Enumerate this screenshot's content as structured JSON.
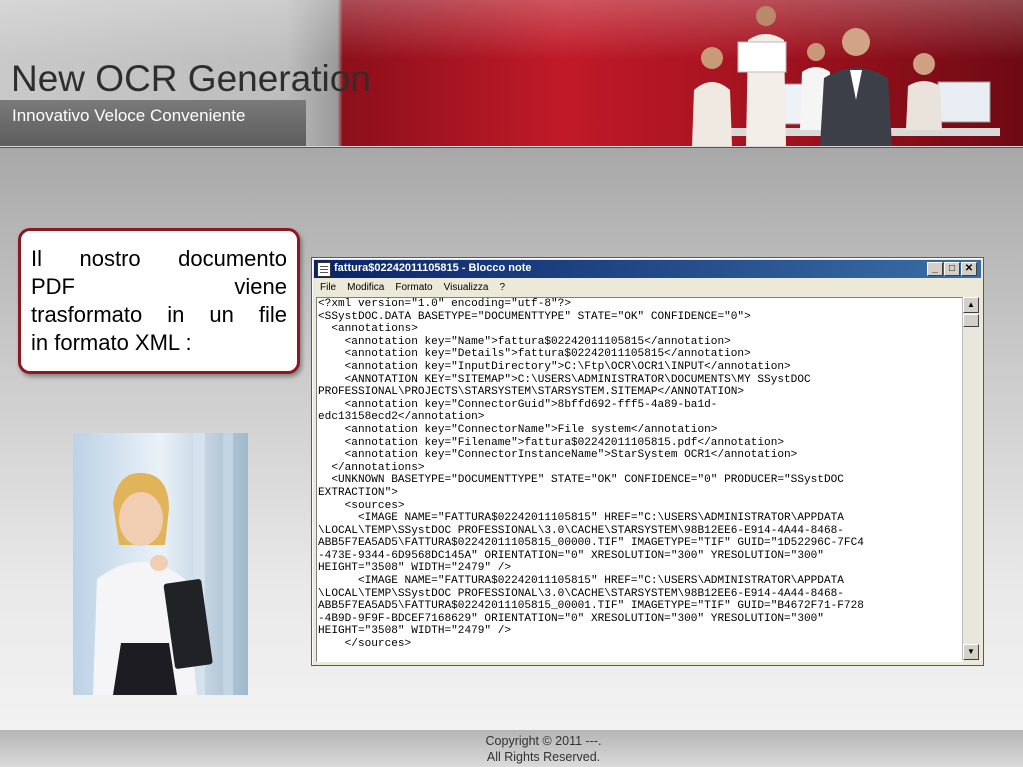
{
  "header": {
    "title": "New OCR Generation",
    "subtitle": "Innovativo Veloce Conveniente"
  },
  "callout": {
    "line1": "Il nostro documento",
    "line2": "PDF viene",
    "line3": "trasformato in un file",
    "line4": "in formato XML :"
  },
  "notepad": {
    "title": "fattura$02242011105815 - Blocco note",
    "menu": [
      "File",
      "Modifica",
      "Formato",
      "Visualizza",
      "?"
    ],
    "lines": [
      "<?xml version=\"1.0\" encoding=\"utf-8\"?>",
      "<SSystDOC.DATA BASETYPE=\"DOCUMENTTYPE\" STATE=\"OK\" CONFIDENCE=\"0\">",
      "  <annotations>",
      "    <annotation key=\"Name\">fattura$02242011105815</annotation>",
      "    <annotation key=\"Details\">fattura$02242011105815</annotation>",
      "    <annotation key=\"InputDirectory\">C:\\Ftp\\OCR\\OCR1\\INPUT</annotation>",
      "    <ANNOTATION KEY=\"SITEMAP\">C:\\USERS\\ADMINISTRATOR\\DOCUMENTS\\MY SSystDOC",
      "PROFESSIONAL\\PROJECTS\\STARSYSTEM\\STARSYSTEM.SITEMAP</ANNOTATION>",
      "    <annotation key=\"ConnectorGuid\">8bffd692-fff5-4a89-ba1d-",
      "edc13158ecd2</annotation>",
      "    <annotation key=\"ConnectorName\">File system</annotation>",
      "    <annotation key=\"Filename\">fattura$02242011105815.pdf</annotation>",
      "    <annotation key=\"ConnectorInstanceName\">StarSystem OCR1</annotation>",
      "  </annotations>",
      "  <UNKNOWN BASETYPE=\"DOCUMENTTYPE\" STATE=\"OK\" CONFIDENCE=\"0\" PRODUCER=\"SSystDOC",
      "EXTRACTION\">",
      "    <sources>",
      "      <IMAGE NAME=\"FATTURA$02242011105815\" HREF=\"C:\\USERS\\ADMINISTRATOR\\APPDATA",
      "\\LOCAL\\TEMP\\SSystDOC PROFESSIONAL\\3.0\\CACHE\\STARSYSTEM\\98B12EE6-E914-4A44-8468-",
      "ABB5F7EA5AD5\\FATTURA$02242011105815_00000.TIF\" IMAGETYPE=\"TIF\" GUID=\"1D52296C-7FC4",
      "-473E-9344-6D9568DC145A\" ORIENTATION=\"0\" XRESOLUTION=\"300\" YRESOLUTION=\"300\"",
      "HEIGHT=\"3508\" WIDTH=\"2479\" />",
      "      <IMAGE NAME=\"FATTURA$02242011105815\" HREF=\"C:\\USERS\\ADMINISTRATOR\\APPDATA",
      "\\LOCAL\\TEMP\\SSystDOC PROFESSIONAL\\3.0\\CACHE\\STARSYSTEM\\98B12EE6-E914-4A44-8468-",
      "ABB5F7EA5AD5\\FATTURA$02242011105815_00001.TIF\" IMAGETYPE=\"TIF\" GUID=\"B4672F71-F728",
      "-4B9D-9F9F-BDCEF7168629\" ORIENTATION=\"0\" XRESOLUTION=\"300\" YRESOLUTION=\"300\"",
      "HEIGHT=\"3508\" WIDTH=\"2479\" />",
      "    </sources>"
    ]
  },
  "footer": {
    "line1": "Copyright © 2011 ---.",
    "line2": "All Rights Reserved."
  }
}
